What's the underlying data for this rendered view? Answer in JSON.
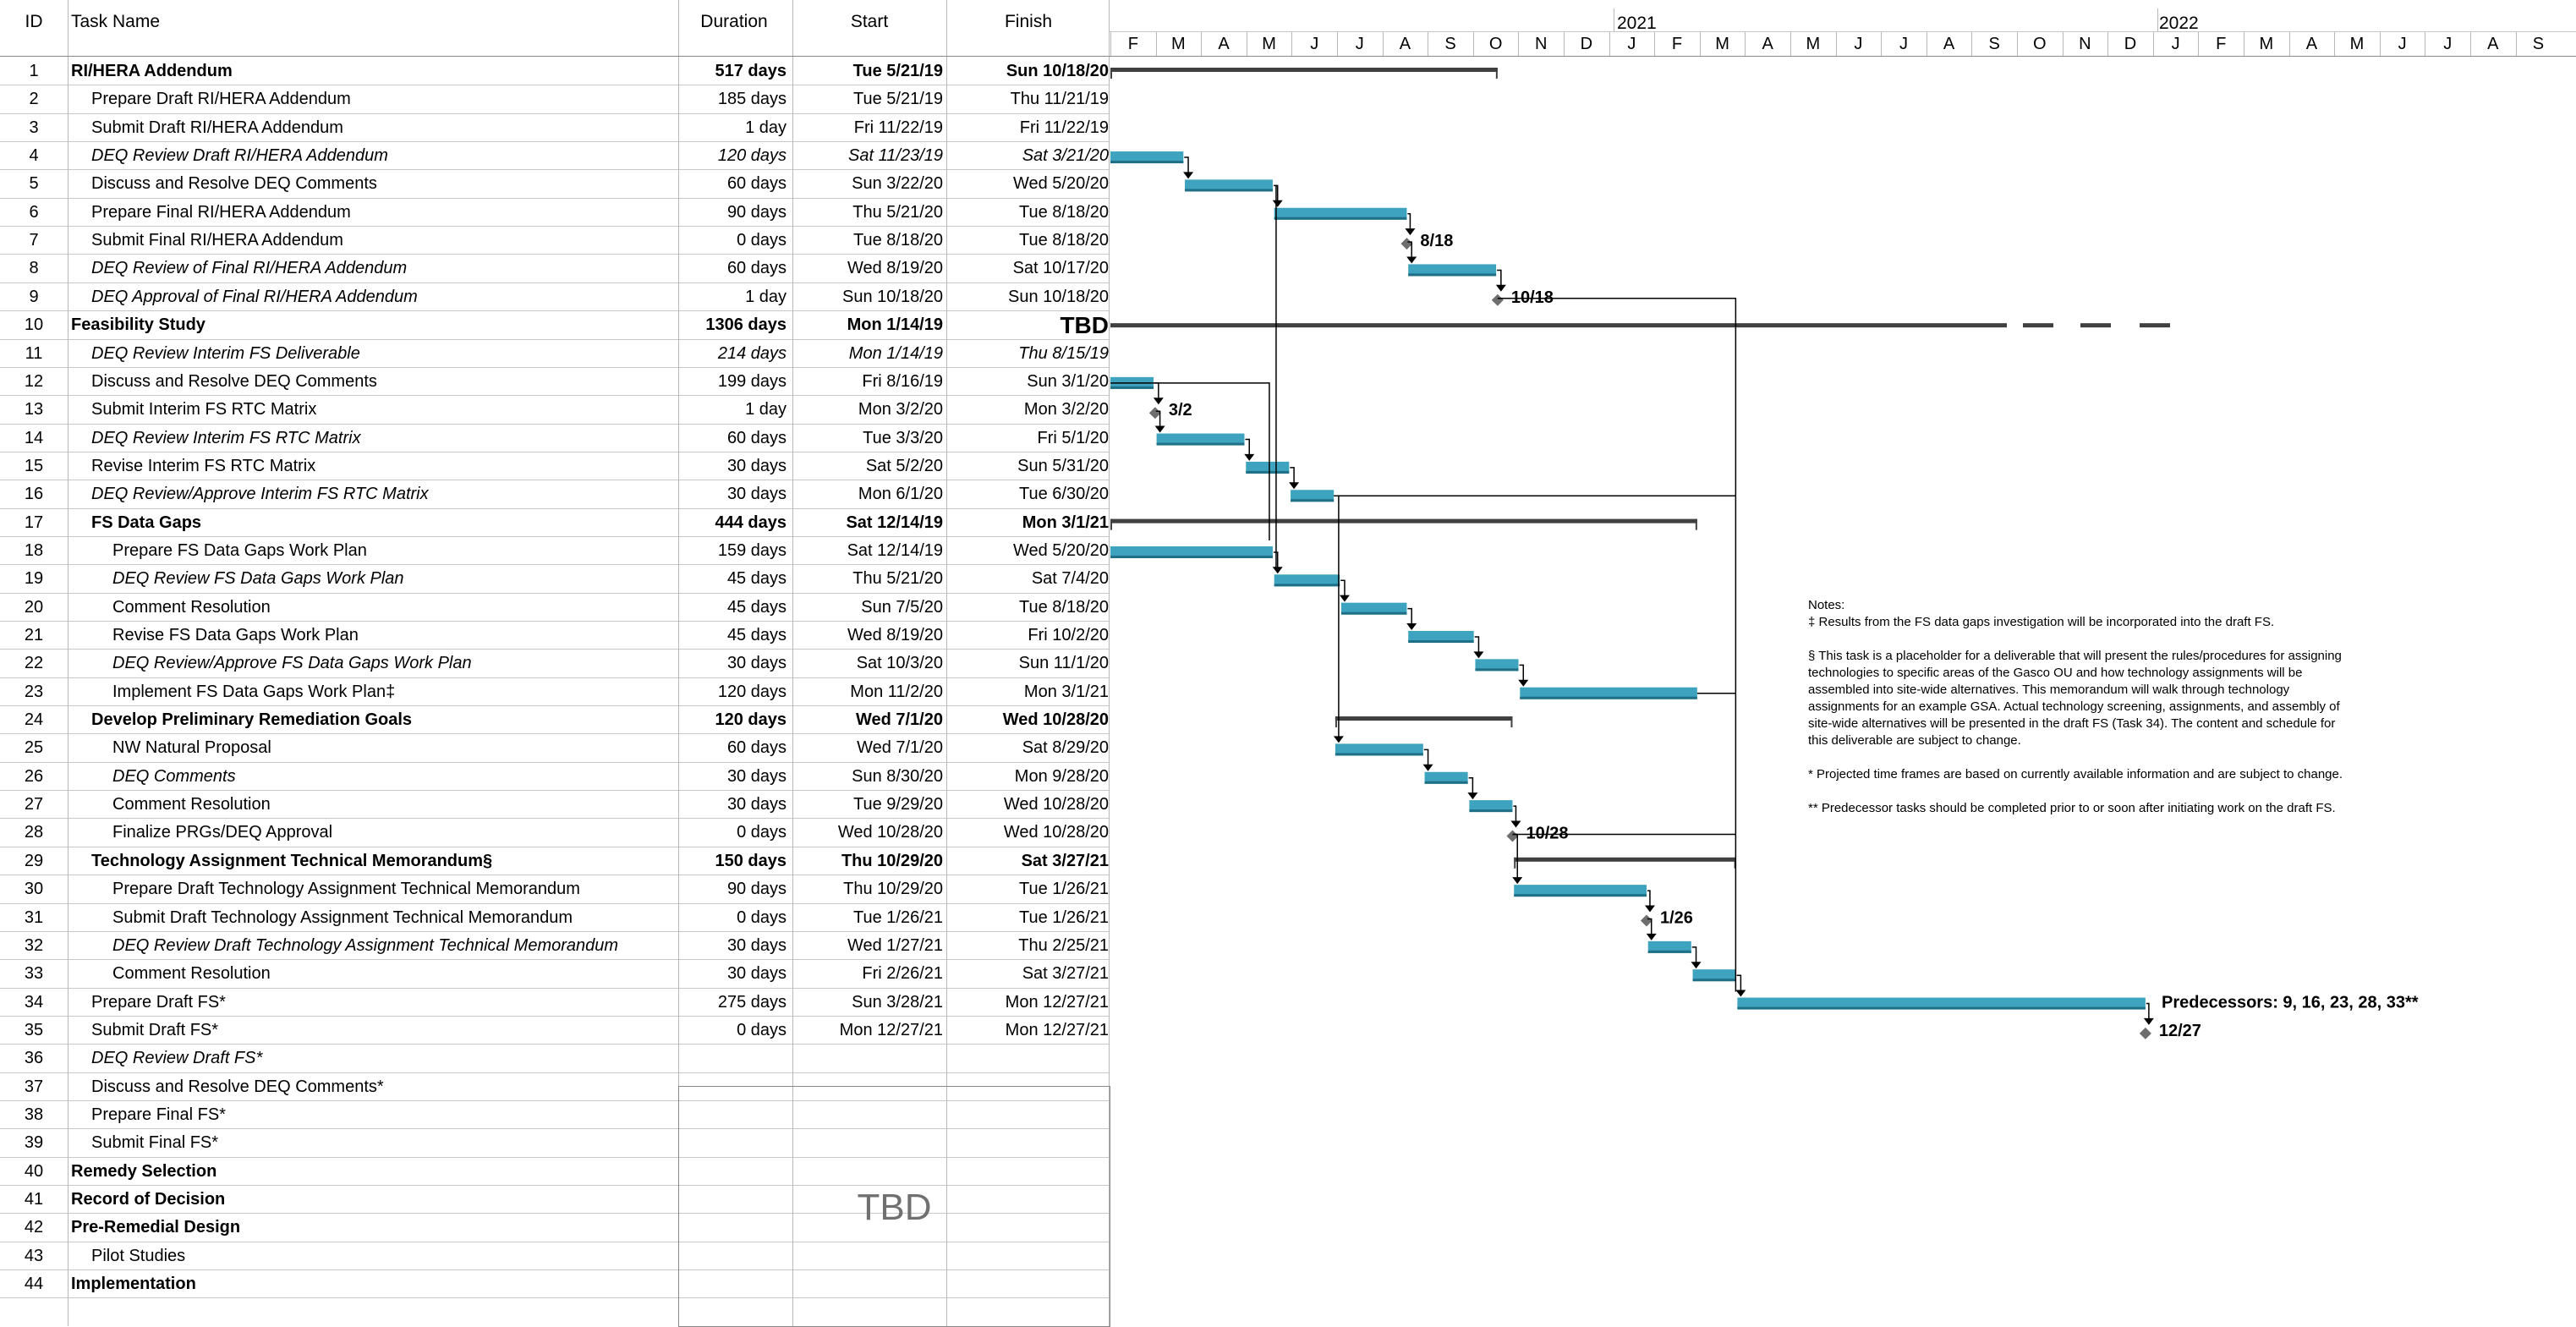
{
  "columns": {
    "id": "ID",
    "name": "Task Name",
    "duration": "Duration",
    "start": "Start",
    "finish": "Finish"
  },
  "years": [
    "2021",
    "2022"
  ],
  "months": [
    "F",
    "M",
    "A",
    "M",
    "J",
    "J",
    "A",
    "S",
    "O",
    "N",
    "D",
    "J",
    "F",
    "M",
    "A",
    "M",
    "J",
    "J",
    "A",
    "S",
    "O",
    "N",
    "D",
    "J",
    "F",
    "M",
    "A",
    "M",
    "J",
    "J",
    "A",
    "S"
  ],
  "tasks": [
    {
      "id": "1",
      "name": "RI/HERA Addendum",
      "duration": "517 days",
      "start": "Tue 5/21/19",
      "finish": "Sun 10/18/20",
      "level": 0,
      "style": "bold"
    },
    {
      "id": "2",
      "name": "Prepare Draft RI/HERA Addendum",
      "duration": "185 days",
      "start": "Tue 5/21/19",
      "finish": "Thu 11/21/19",
      "level": 1,
      "style": "normal"
    },
    {
      "id": "3",
      "name": "Submit Draft RI/HERA Addendum",
      "duration": "1 day",
      "start": "Fri 11/22/19",
      "finish": "Fri 11/22/19",
      "level": 1,
      "style": "normal"
    },
    {
      "id": "4",
      "name": "DEQ Review Draft RI/HERA Addendum",
      "duration": "120 days",
      "start": "Sat 11/23/19",
      "finish": "Sat 3/21/20",
      "level": 1,
      "style": "italic"
    },
    {
      "id": "5",
      "name": "Discuss and Resolve DEQ Comments",
      "duration": "60 days",
      "start": "Sun 3/22/20",
      "finish": "Wed 5/20/20",
      "level": 1,
      "style": "normal"
    },
    {
      "id": "6",
      "name": "Prepare Final RI/HERA Addendum",
      "duration": "90 days",
      "start": "Thu 5/21/20",
      "finish": "Tue 8/18/20",
      "level": 1,
      "style": "normal"
    },
    {
      "id": "7",
      "name": "Submit Final RI/HERA Addendum",
      "duration": "0 days",
      "start": "Tue 8/18/20",
      "finish": "Tue 8/18/20",
      "level": 1,
      "style": "normal"
    },
    {
      "id": "8",
      "name": "DEQ Review of Final RI/HERA Addendum",
      "duration": "60 days",
      "start": "Wed 8/19/20",
      "finish": "Sat 10/17/20",
      "level": 1,
      "style": "italic"
    },
    {
      "id": "9",
      "name": "DEQ Approval of Final RI/HERA Addendum",
      "duration": "1 day",
      "start": "Sun 10/18/20",
      "finish": "Sun 10/18/20",
      "level": 1,
      "style": "italic"
    },
    {
      "id": "10",
      "name": "Feasibility Study",
      "duration": "1306 days",
      "start": "Mon 1/14/19",
      "finish": "TBD",
      "level": 0,
      "style": "bold"
    },
    {
      "id": "11",
      "name": "DEQ Review Interim FS Deliverable",
      "duration": "214 days",
      "start": "Mon 1/14/19",
      "finish": "Thu 8/15/19",
      "level": 1,
      "style": "italic-all"
    },
    {
      "id": "12",
      "name": "Discuss and Resolve DEQ Comments",
      "duration": "199 days",
      "start": "Fri 8/16/19",
      "finish": "Sun 3/1/20",
      "level": 1,
      "style": "normal"
    },
    {
      "id": "13",
      "name": "Submit Interim FS RTC Matrix",
      "duration": "1 day",
      "start": "Mon 3/2/20",
      "finish": "Mon 3/2/20",
      "level": 1,
      "style": "normal"
    },
    {
      "id": "14",
      "name": "DEQ Review Interim FS RTC Matrix",
      "duration": "60 days",
      "start": "Tue 3/3/20",
      "finish": "Fri 5/1/20",
      "level": 1,
      "style": "italic"
    },
    {
      "id": "15",
      "name": "Revise Interim FS RTC Matrix",
      "duration": "30 days",
      "start": "Sat 5/2/20",
      "finish": "Sun 5/31/20",
      "level": 1,
      "style": "normal"
    },
    {
      "id": "16",
      "name": "DEQ Review/Approve Interim FS RTC Matrix",
      "duration": "30 days",
      "start": "Mon 6/1/20",
      "finish": "Tue 6/30/20",
      "level": 1,
      "style": "italic"
    },
    {
      "id": "17",
      "name": "FS Data Gaps",
      "duration": "444 days",
      "start": "Sat 12/14/19",
      "finish": "Mon 3/1/21",
      "level": 1,
      "style": "bold"
    },
    {
      "id": "18",
      "name": "Prepare FS Data Gaps Work Plan",
      "duration": "159 days",
      "start": "Sat 12/14/19",
      "finish": "Wed 5/20/20",
      "level": 2,
      "style": "normal"
    },
    {
      "id": "19",
      "name": "DEQ Review FS Data Gaps Work Plan",
      "duration": "45 days",
      "start": "Thu 5/21/20",
      "finish": "Sat 7/4/20",
      "level": 2,
      "style": "italic"
    },
    {
      "id": "20",
      "name": "Comment Resolution",
      "duration": "45 days",
      "start": "Sun 7/5/20",
      "finish": "Tue 8/18/20",
      "level": 2,
      "style": "normal"
    },
    {
      "id": "21",
      "name": "Revise FS Data Gaps Work Plan",
      "duration": "45 days",
      "start": "Wed 8/19/20",
      "finish": "Fri 10/2/20",
      "level": 2,
      "style": "normal"
    },
    {
      "id": "22",
      "name": "DEQ Review/Approve FS Data Gaps Work Plan",
      "duration": "30 days",
      "start": "Sat 10/3/20",
      "finish": "Sun 11/1/20",
      "level": 2,
      "style": "italic"
    },
    {
      "id": "23",
      "name": "Implement FS Data Gaps Work Plan‡",
      "duration": "120 days",
      "start": "Mon 11/2/20",
      "finish": "Mon 3/1/21",
      "level": 2,
      "style": "normal"
    },
    {
      "id": "24",
      "name": "Develop Preliminary Remediation Goals",
      "duration": "120 days",
      "start": "Wed 7/1/20",
      "finish": "Wed 10/28/20",
      "level": 1,
      "style": "bold"
    },
    {
      "id": "25",
      "name": "NW Natural Proposal",
      "duration": "60 days",
      "start": "Wed 7/1/20",
      "finish": "Sat 8/29/20",
      "level": 2,
      "style": "normal"
    },
    {
      "id": "26",
      "name": "DEQ Comments",
      "duration": "30 days",
      "start": "Sun 8/30/20",
      "finish": "Mon 9/28/20",
      "level": 2,
      "style": "italic"
    },
    {
      "id": "27",
      "name": "Comment Resolution",
      "duration": "30 days",
      "start": "Tue 9/29/20",
      "finish": "Wed 10/28/20",
      "level": 2,
      "style": "normal"
    },
    {
      "id": "28",
      "name": "Finalize PRGs/DEQ Approval",
      "duration": "0 days",
      "start": "Wed 10/28/20",
      "finish": "Wed 10/28/20",
      "level": 2,
      "style": "normal"
    },
    {
      "id": "29",
      "name": "Technology Assignment Technical Memorandum§",
      "duration": "150 days",
      "start": "Thu 10/29/20",
      "finish": "Sat 3/27/21",
      "level": 1,
      "style": "bold"
    },
    {
      "id": "30",
      "name": "Prepare Draft Technology Assignment Technical Memorandum",
      "duration": "90 days",
      "start": "Thu 10/29/20",
      "finish": "Tue 1/26/21",
      "level": 2,
      "style": "normal"
    },
    {
      "id": "31",
      "name": "Submit Draft Technology Assignment Technical Memorandum",
      "duration": "0 days",
      "start": "Tue 1/26/21",
      "finish": "Tue 1/26/21",
      "level": 2,
      "style": "normal"
    },
    {
      "id": "32",
      "name": "DEQ Review Draft Technology Assignment Technical Memorandum",
      "duration": "30 days",
      "start": "Wed 1/27/21",
      "finish": "Thu 2/25/21",
      "level": 2,
      "style": "italic"
    },
    {
      "id": "33",
      "name": "Comment Resolution",
      "duration": "30 days",
      "start": "Fri 2/26/21",
      "finish": "Sat 3/27/21",
      "level": 2,
      "style": "normal"
    },
    {
      "id": "34",
      "name": "Prepare Draft FS*",
      "duration": "275 days",
      "start": "Sun 3/28/21",
      "finish": "Mon 12/27/21",
      "level": 1,
      "style": "normal"
    },
    {
      "id": "35",
      "name": "Submit Draft FS*",
      "duration": "0 days",
      "start": "Mon 12/27/21",
      "finish": "Mon 12/27/21",
      "level": 1,
      "style": "normal"
    },
    {
      "id": "36",
      "name": "DEQ Review Draft FS*",
      "duration": "",
      "start": "",
      "finish": "",
      "level": 1,
      "style": "italic"
    },
    {
      "id": "37",
      "name": "Discuss and Resolve DEQ Comments*",
      "duration": "",
      "start": "",
      "finish": "",
      "level": 1,
      "style": "normal"
    },
    {
      "id": "38",
      "name": "Prepare Final FS*",
      "duration": "",
      "start": "",
      "finish": "",
      "level": 1,
      "style": "normal"
    },
    {
      "id": "39",
      "name": "Submit Final FS*",
      "duration": "",
      "start": "",
      "finish": "",
      "level": 1,
      "style": "normal"
    },
    {
      "id": "40",
      "name": "Remedy Selection",
      "duration": "",
      "start": "",
      "finish": "",
      "level": 0,
      "style": "bold"
    },
    {
      "id": "41",
      "name": "Record of Decision",
      "duration": "",
      "start": "",
      "finish": "",
      "level": 0,
      "style": "bold"
    },
    {
      "id": "42",
      "name": "Pre-Remedial Design",
      "duration": "",
      "start": "",
      "finish": "",
      "level": 0,
      "style": "bold"
    },
    {
      "id": "43",
      "name": "Pilot Studies",
      "duration": "",
      "start": "",
      "finish": "",
      "level": 1,
      "style": "normal"
    },
    {
      "id": "44",
      "name": "Implementation",
      "duration": "",
      "start": "",
      "finish": "",
      "level": 0,
      "style": "bold"
    }
  ],
  "tbd_label": "TBD",
  "milestones": {
    "m7": "8/18",
    "m9": "10/18",
    "m13": "3/2",
    "m28": "10/28",
    "m31": "1/26",
    "m35": "12/27"
  },
  "predecessors_label": "Predecessors: 9, 16, 23, 28, 33**",
  "notes": {
    "title": "Notes:",
    "n1": "‡ Results from the FS data gaps investigation will be incorporated into the draft FS.",
    "n2": "§ This task is a placeholder for a deliverable that will present the rules/procedures for assigning technologies to specific areas of the Gasco OU and how technology assignments will be assembled into site-wide alternatives. This memorandum will walk through technology assignments for an example GSA. Actual technology screening, assignments, and assembly of site-wide alternatives will be presented in the draft FS (Task 34). The content and schedule for this deliverable are subject to change.",
    "n3": "* Projected time frames are based on currently available information and are subject to change.",
    "n4": "** Predecessor tasks should be completed prior to or soon after initiating work on the draft FS."
  },
  "colors": {
    "bar": "#3ea3bf",
    "bar_dark": "#1f6f86",
    "summary": "#404040",
    "milestone": "#6e6e6e",
    "link": "#000000"
  }
}
